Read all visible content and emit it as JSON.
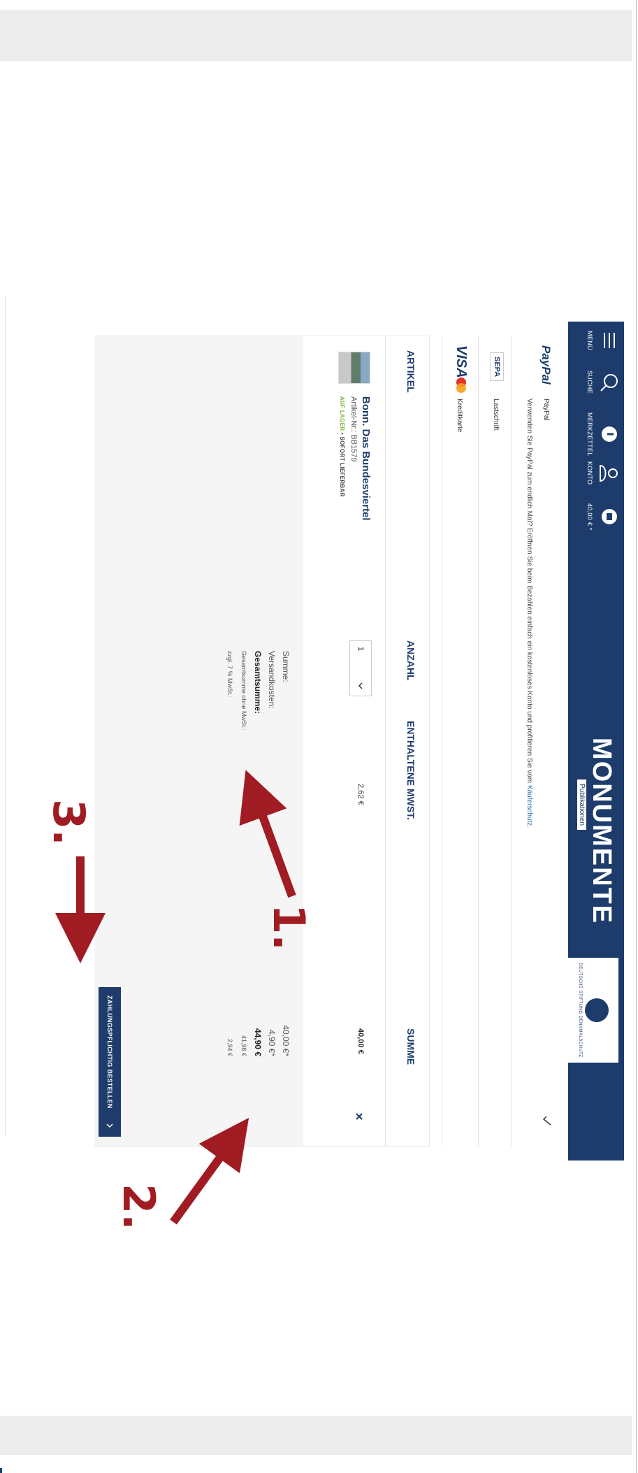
{
  "header": {
    "nav": [
      {
        "label": "MENÜ",
        "icon": "menu-icon"
      },
      {
        "label": "SUCHE",
        "icon": "search-icon"
      },
      {
        "label": "MERKZETTEL",
        "icon": "wishlist-icon"
      },
      {
        "label": "KONTO",
        "icon": "account-icon"
      },
      {
        "label": "40,00 € *",
        "icon": "cart-icon"
      }
    ],
    "logo_text": "MONUMENTE",
    "logo_sub": "Publikationen",
    "foundation_text": "DEUTSCHE STIFTUNG DENKMALSCHUTZ"
  },
  "payment": {
    "paypal": {
      "brand": "PayPal",
      "name": "PayPal",
      "description": "Verwenden Sie PayPal zum endlich Mal? Eröffnen Sie beim Bezahlen einfach ein kostenloses Konto und profitieren Sie vom",
      "link": "Käuferschutz."
    },
    "sepa": {
      "brand": "SEPA",
      "name": "Lastschrift"
    },
    "card": {
      "brand": "VISA",
      "name": "Kreditkarte"
    }
  },
  "cart": {
    "headers": {
      "article": "ARTIKEL",
      "qty": "ANZAHL",
      "vat": "ENTHALTENE MWST.",
      "sum": "SUMME"
    },
    "item": {
      "title": "Bonn. Das Bundesviertel",
      "article_no": "Artikel-Nr.: BB1579",
      "stock_green": "AUF LAGER",
      "stock_rest": " • SOFORT LIEFERBAR",
      "qty": "1",
      "vat": "2,62 €",
      "sum": "40,00 €"
    },
    "totals": [
      {
        "label": "Summe:",
        "value": "40,00 €*"
      },
      {
        "label": "Versandkosten:",
        "value": "4,90 €*"
      },
      {
        "label": "Gesamtsumme:",
        "value": "44,90 €"
      },
      {
        "label": "Gesamtsumme ohne MwSt.:",
        "value": "41,96 €"
      },
      {
        "label": "zzgl. 7 % MwSt.:",
        "value": "2,94 €"
      }
    ]
  },
  "order_button": "ZAHLUNGSPFLICHTIG BESTELLEN",
  "annotations": {
    "one": "1.",
    "two": "2.",
    "three": "3."
  },
  "colors": {
    "primary": "#1d3c6c",
    "annotation": "#a01c22",
    "stock": "#7cb342"
  }
}
